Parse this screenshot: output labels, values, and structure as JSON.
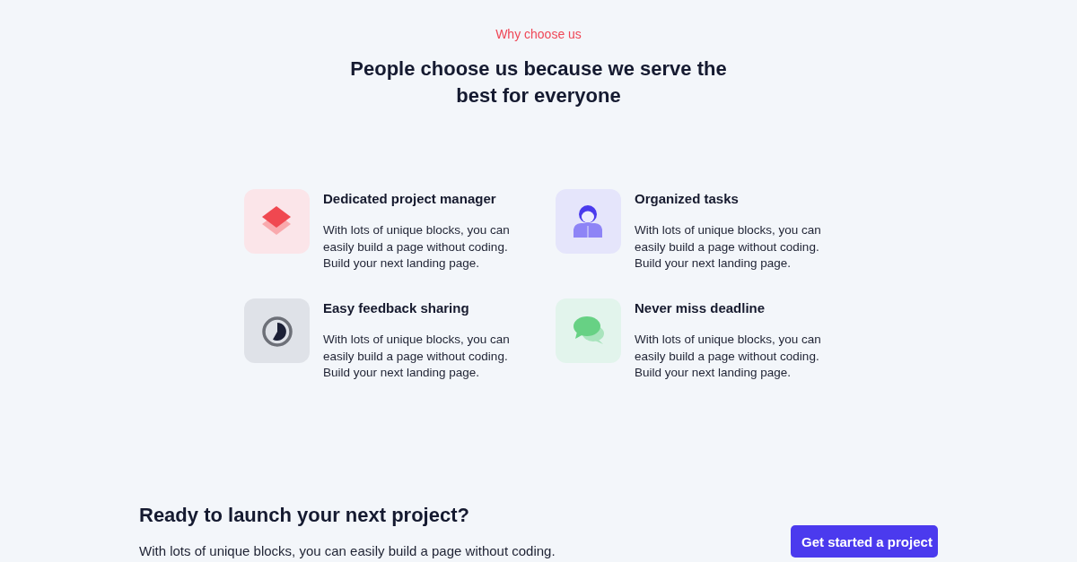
{
  "eyebrow": "Why choose us",
  "heading": "People choose us because we serve the best for everyone",
  "features": [
    {
      "title": "Dedicated project manager",
      "description": "With lots of unique blocks, you can easily build a page without coding. Build your next landing page."
    },
    {
      "title": "Organized tasks",
      "description": "With lots of unique blocks, you can easily build a page without coding. Build your next landing page."
    },
    {
      "title": "Easy feedback sharing",
      "description": "With lots of unique blocks, you can easily build a page without coding. Build your next landing page."
    },
    {
      "title": "Never miss deadline",
      "description": "With lots of unique blocks, you can easily build a page without coding. Build your next landing page."
    }
  ],
  "cta": {
    "heading": "Ready to launch your next project?",
    "text": "With lots of unique blocks, you can easily build a page without coding.",
    "button": "Get started a project"
  }
}
